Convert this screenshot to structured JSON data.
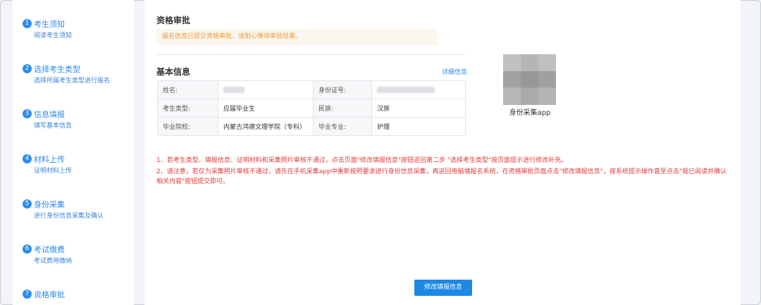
{
  "sidebar": {
    "steps": [
      {
        "num": "1",
        "title": "考生须知",
        "desc": "阅读考生须知"
      },
      {
        "num": "2",
        "title": "选择考生类型",
        "desc": "选择所属考生类型进行报名"
      },
      {
        "num": "3",
        "title": "信息填报",
        "desc": "填写基本信息"
      },
      {
        "num": "4",
        "title": "材料上传",
        "desc": "证明材料上传"
      },
      {
        "num": "5",
        "title": "身份采集",
        "desc": "进行身份信息采集及确认"
      },
      {
        "num": "6",
        "title": "考试缴费",
        "desc": "考试费用缴纳"
      },
      {
        "num": "7",
        "title": "资格审批",
        "desc": ""
      }
    ]
  },
  "main": {
    "title": "资格审批",
    "notice": "报名信息已提交资格审批，请耐心等待审批结果。",
    "basic_info_title": "基本信息",
    "detail_link": "详细信息",
    "table": {
      "name_label": "姓名:",
      "id_label": "身份证号:",
      "type_label": "考生类型:",
      "type_value": "应届毕业生",
      "ethnic_label": "民族:",
      "ethnic_value": "汉族",
      "school_label": "毕业院校:",
      "school_value": "内蒙古鸿德文理学院（专科）",
      "major_label": "毕业专业:",
      "major_value": "护理"
    },
    "photo_caption": "身份采集app",
    "notes": [
      "1、若考生类型、填报信息、证明材料和采集照片审核不通过，点击页面\"修改填报信息\"按钮返回第二步 \"选择考生类型\"按页面提示进行修改补充。",
      "2、请注意，若仅为采集照片审核不通过，请先在手机采集app中重新按照要求进行身份信息采集，再返回电脑端报名系统，在资格审批页面点击\"修改填报信息\"，按系统提示操作直至点击\"我已阅读并确认相关内容\"按钮提交即可。"
    ],
    "submit_label": "修改填报信息"
  },
  "colors": {
    "accent": "#2d8cf0",
    "notice_text": "#f09a3a",
    "warning_text": "#e23b3b",
    "button": "#1e88e5"
  }
}
